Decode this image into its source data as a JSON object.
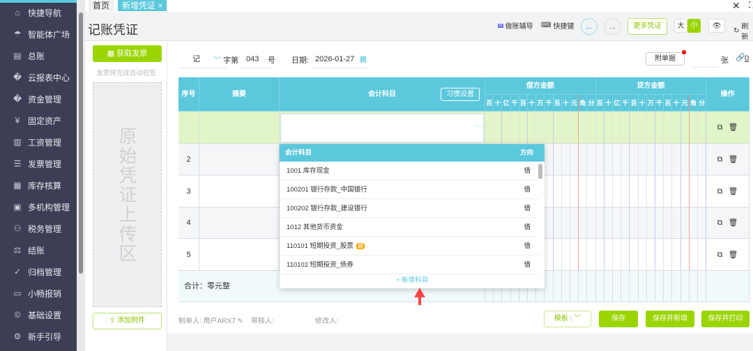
{
  "sidebar": {
    "items": [
      {
        "label": "快捷导航",
        "icon": "home-icon"
      },
      {
        "label": "智能体广场",
        "icon": "umbrella-icon"
      },
      {
        "label": "总账",
        "icon": "ledger-icon"
      },
      {
        "label": "云报表中心",
        "icon": "chart-icon"
      },
      {
        "label": "资金管理",
        "icon": "money-icon"
      },
      {
        "label": "固定资产",
        "icon": "asset-icon"
      },
      {
        "label": "工资管理",
        "icon": "salary-icon"
      },
      {
        "label": "发票管理",
        "icon": "invoice-icon"
      },
      {
        "label": "库存核算",
        "icon": "warehouse-icon"
      },
      {
        "label": "多机构管理",
        "icon": "org-icon"
      },
      {
        "label": "税务管理",
        "icon": "tax-icon"
      },
      {
        "label": "结账",
        "icon": "close-books-icon"
      },
      {
        "label": "归档管理",
        "icon": "archive-icon"
      },
      {
        "label": "小畅报销",
        "icon": "reimburse-icon"
      },
      {
        "label": "基础设置",
        "icon": "settings-icon"
      },
      {
        "label": "新手引导",
        "icon": "guide-icon"
      }
    ]
  },
  "tabs": [
    {
      "label": "首页"
    },
    {
      "label": "新增凭证"
    }
  ],
  "header": {
    "title": "记账凭证",
    "ai_help": "做账辅导",
    "shortcuts": "快捷键",
    "more": "更多凭证",
    "size_large": "大",
    "size_small": "小",
    "refresh": "刷新"
  },
  "left": {
    "get_invoice": "获取发票",
    "hint": "发票将完成自动验签",
    "upload": "原始凭证上传区",
    "add_attachment": "添加附件"
  },
  "voucher": {
    "word": "记",
    "word_label": "字第",
    "number": "043",
    "number_suffix": "号",
    "date_label": "日期:",
    "date": "2026-01-27",
    "attach_btn": "附单据",
    "attach_unit": "张",
    "attach_count": "0"
  },
  "table": {
    "col_seq": "序号",
    "col_summary": "摘要",
    "col_subject": "会计科目",
    "habit": "习惯设置",
    "debit": "借方金额",
    "credit": "贷方金额",
    "ops": "操作",
    "digits": [
      "百",
      "十",
      "亿",
      "千",
      "百",
      "十",
      "万",
      "千",
      "百",
      "十",
      "元",
      "角",
      "分"
    ],
    "rows": [
      "",
      "2",
      "3",
      "4",
      "5"
    ],
    "total": "合计：零元整"
  },
  "dropdown": {
    "col_subject": "会计科目",
    "col_dir": "方向",
    "items": [
      {
        "name": "1001 库存现金",
        "dir": "借"
      },
      {
        "name": "100201 银行存款_中国银行",
        "dir": "借"
      },
      {
        "name": "100202 银行存款_建设银行",
        "dir": "借"
      },
      {
        "name": "1012 其他货币资金",
        "dir": "借"
      },
      {
        "name": "110101 短期投资_股票",
        "dir": "借",
        "badge": "辅"
      },
      {
        "name": "110102 短期投资_债券",
        "dir": "借"
      }
    ],
    "add": "+ 新增科目"
  },
  "footer": {
    "maker": "制单人: 用户ARX7",
    "reviewer": "审核人:",
    "modifier": "修改人:",
    "template": "模板",
    "save": "保存",
    "save_new": "保存并新增",
    "save_print": "保存并打印"
  }
}
